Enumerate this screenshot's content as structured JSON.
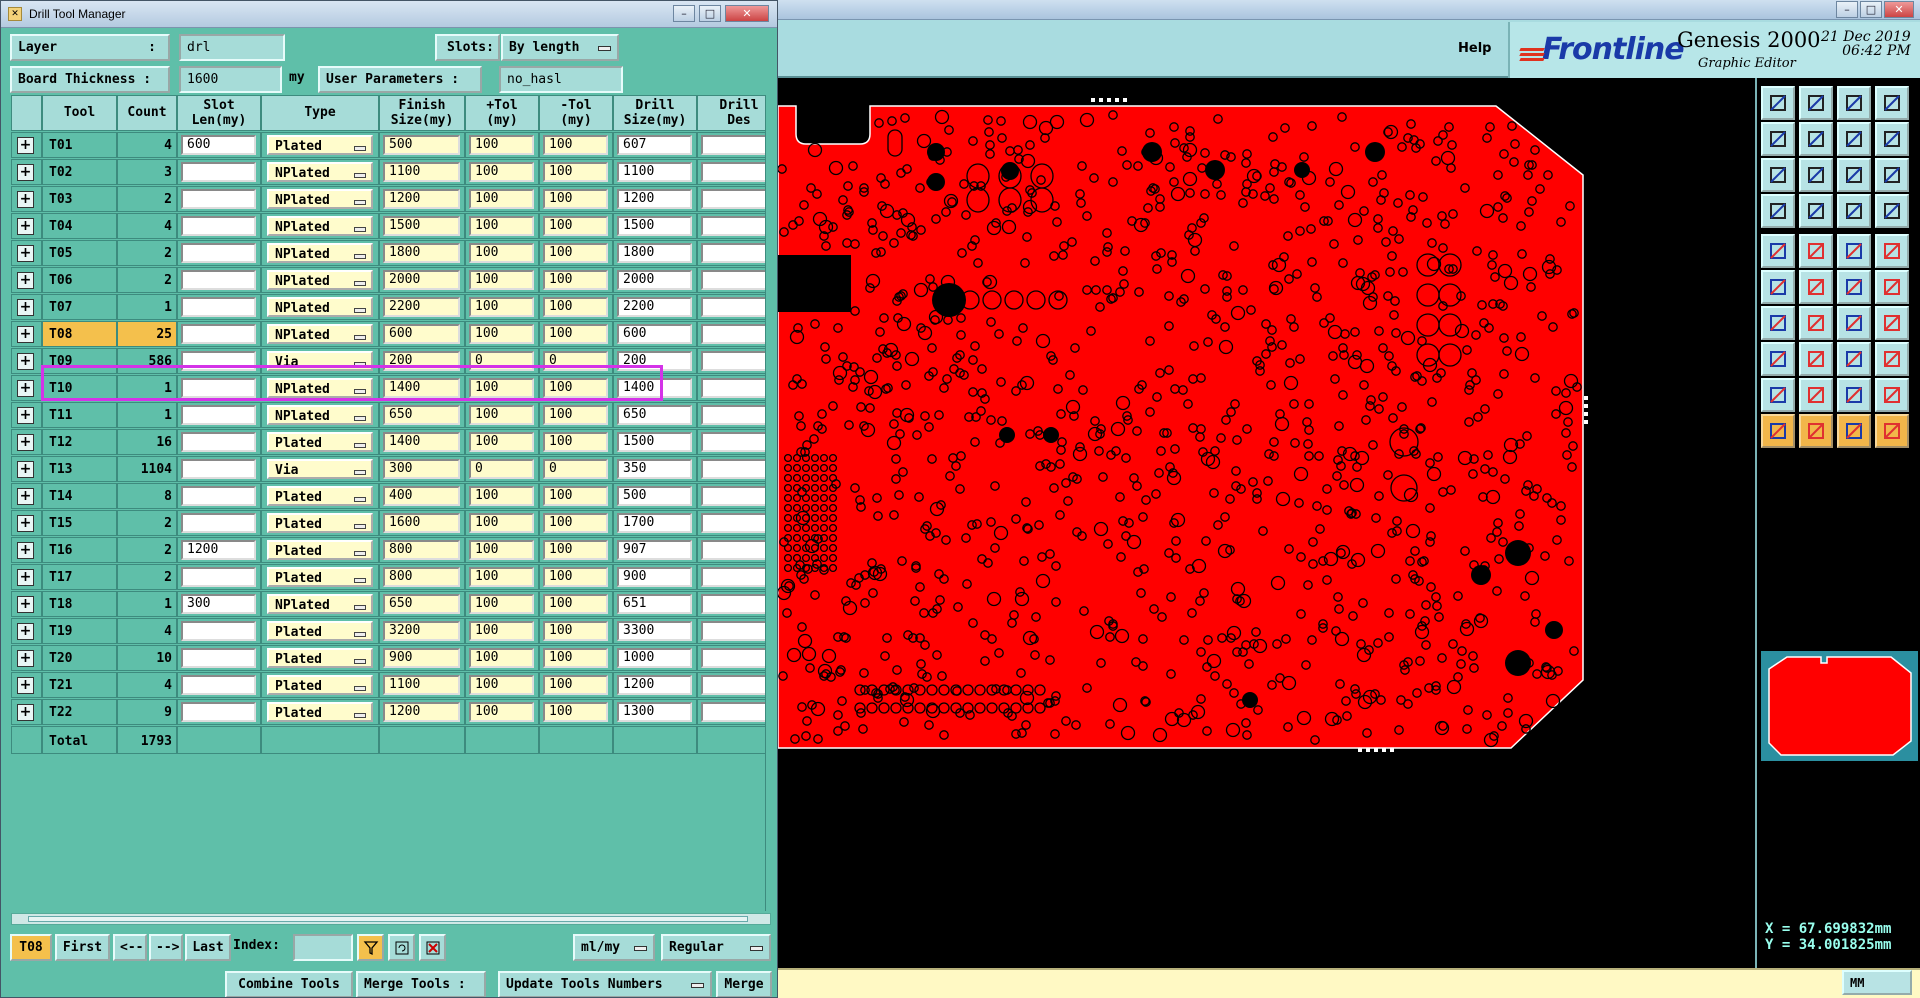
{
  "window": {
    "title": "Drill Tool Manager"
  },
  "form": {
    "layer_label": "Layer",
    "layer_sep": ":",
    "layer_value": "drl",
    "slots_label": "Slots:",
    "slots_value": "By length",
    "thickness_label": "Board Thickness :",
    "thickness_value": "1600",
    "thickness_unit": "my",
    "user_params_label": "User Parameters :",
    "user_params_value": "no_hasl"
  },
  "table": {
    "headers": [
      "Tool",
      "Count",
      "Slot\nLen(my)",
      "Type",
      "Finish\nSize(my)",
      "+Tol\n(my)",
      "-Tol\n(my)",
      "Drill\nSize(my)",
      "Drill\nDes"
    ],
    "rows": [
      {
        "tool": "T01",
        "count": "4",
        "slot": "600",
        "type": "Plated",
        "finish": "500",
        "ptol": "100",
        "mtol": "100",
        "drill": "607"
      },
      {
        "tool": "T02",
        "count": "3",
        "slot": "",
        "type": "NPlated",
        "finish": "1100",
        "ptol": "100",
        "mtol": "100",
        "drill": "1100"
      },
      {
        "tool": "T03",
        "count": "2",
        "slot": "",
        "type": "NPlated",
        "finish": "1200",
        "ptol": "100",
        "mtol": "100",
        "drill": "1200"
      },
      {
        "tool": "T04",
        "count": "4",
        "slot": "",
        "type": "NPlated",
        "finish": "1500",
        "ptol": "100",
        "mtol": "100",
        "drill": "1500"
      },
      {
        "tool": "T05",
        "count": "2",
        "slot": "",
        "type": "NPlated",
        "finish": "1800",
        "ptol": "100",
        "mtol": "100",
        "drill": "1800"
      },
      {
        "tool": "T06",
        "count": "2",
        "slot": "",
        "type": "NPlated",
        "finish": "2000",
        "ptol": "100",
        "mtol": "100",
        "drill": "2000"
      },
      {
        "tool": "T07",
        "count": "1",
        "slot": "",
        "type": "NPlated",
        "finish": "2200",
        "ptol": "100",
        "mtol": "100",
        "drill": "2200"
      },
      {
        "tool": "T08",
        "count": "25",
        "slot": "",
        "type": "NPlated",
        "finish": "600",
        "ptol": "100",
        "mtol": "100",
        "drill": "600",
        "selected": true
      },
      {
        "tool": "T09",
        "count": "586",
        "slot": "",
        "type": "Via",
        "finish": "200",
        "ptol": "0",
        "mtol": "0",
        "drill": "200"
      },
      {
        "tool": "T10",
        "count": "1",
        "slot": "",
        "type": "NPlated",
        "finish": "1400",
        "ptol": "100",
        "mtol": "100",
        "drill": "1400"
      },
      {
        "tool": "T11",
        "count": "1",
        "slot": "",
        "type": "NPlated",
        "finish": "650",
        "ptol": "100",
        "mtol": "100",
        "drill": "650"
      },
      {
        "tool": "T12",
        "count": "16",
        "slot": "",
        "type": "Plated",
        "finish": "1400",
        "ptol": "100",
        "mtol": "100",
        "drill": "1500"
      },
      {
        "tool": "T13",
        "count": "1104",
        "slot": "",
        "type": "Via",
        "finish": "300",
        "ptol": "0",
        "mtol": "0",
        "drill": "350"
      },
      {
        "tool": "T14",
        "count": "8",
        "slot": "",
        "type": "Plated",
        "finish": "400",
        "ptol": "100",
        "mtol": "100",
        "drill": "500"
      },
      {
        "tool": "T15",
        "count": "2",
        "slot": "",
        "type": "Plated",
        "finish": "1600",
        "ptol": "100",
        "mtol": "100",
        "drill": "1700"
      },
      {
        "tool": "T16",
        "count": "2",
        "slot": "1200",
        "type": "Plated",
        "finish": "800",
        "ptol": "100",
        "mtol": "100",
        "drill": "907"
      },
      {
        "tool": "T17",
        "count": "2",
        "slot": "",
        "type": "Plated",
        "finish": "800",
        "ptol": "100",
        "mtol": "100",
        "drill": "900"
      },
      {
        "tool": "T18",
        "count": "1",
        "slot": "300",
        "type": "NPlated",
        "finish": "650",
        "ptol": "100",
        "mtol": "100",
        "drill": "651"
      },
      {
        "tool": "T19",
        "count": "4",
        "slot": "",
        "type": "Plated",
        "finish": "3200",
        "ptol": "100",
        "mtol": "100",
        "drill": "3300"
      },
      {
        "tool": "T20",
        "count": "10",
        "slot": "",
        "type": "Plated",
        "finish": "900",
        "ptol": "100",
        "mtol": "100",
        "drill": "1000"
      },
      {
        "tool": "T21",
        "count": "4",
        "slot": "",
        "type": "Plated",
        "finish": "1100",
        "ptol": "100",
        "mtol": "100",
        "drill": "1200"
      },
      {
        "tool": "T22",
        "count": "9",
        "slot": "",
        "type": "Plated",
        "finish": "1200",
        "ptol": "100",
        "mtol": "100",
        "drill": "1300"
      }
    ],
    "total_label": "Total",
    "total_value": "1793"
  },
  "nav": {
    "current_tool": "T08",
    "first": "First",
    "prev": "<--",
    "next": "-->",
    "last": "Last",
    "index_label": "Index:",
    "units": "ml/my",
    "mode": "Regular"
  },
  "actions": {
    "combine": "Combine Tools",
    "merge_tools": "Merge Tools :",
    "update": "Update Tools Numbers",
    "merge": "Merge"
  },
  "editor": {
    "help": "Help",
    "brand": "Frontline",
    "product": "Genesis 2000",
    "subtitle": "Graphic Editor",
    "date": "21 Dec 2019",
    "time": "06:42 PM",
    "coord_x": "X = 67.699832mm",
    "coord_y": "Y = 34.001825mm",
    "unit": "MM"
  },
  "colors": {
    "board": "#ff0000",
    "panel_teal": "#5fbfa9",
    "highlight": "#d433e8",
    "selected_tool": "#f4c04c"
  }
}
